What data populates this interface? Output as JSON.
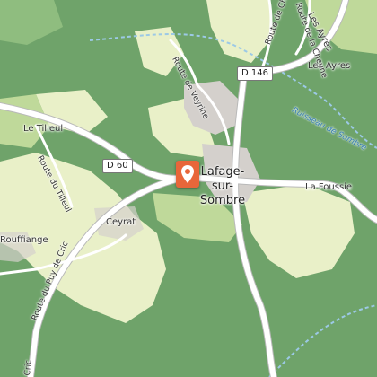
{
  "map": {
    "places": {
      "town": "Lafage-sur-Sombre",
      "le_tilleul": "Le Tilleul",
      "ceyrat": "Ceyrat",
      "rouffiange": "Rouffiange",
      "la_foussie": "La Foussie",
      "les_ayres": "Les Ayres",
      "les_ayres_road": "Les Ayres"
    },
    "roads": {
      "d146": "D 146",
      "d60": "D 60",
      "route_du_tilleul": "Route du Tilleul",
      "route_puy_de_cric": "Route du Puy de Cric",
      "route_de_veyrine": "Route de Veyrine",
      "route_de_ch": "Route de Ch",
      "route_de_la_cheyne": "Route de la Cheyne",
      "cric_bottom": "Cric"
    },
    "water": {
      "ruisseau": "Ruisseau de Sombre"
    },
    "colors": {
      "forest": "#6fa36a",
      "meadow": "#e9f0c8",
      "light_green": "#bfd99a",
      "road": "#ffffff",
      "stream": "#9cc9e6",
      "built": "#d4d0cc",
      "marker": "#e8663a"
    }
  }
}
